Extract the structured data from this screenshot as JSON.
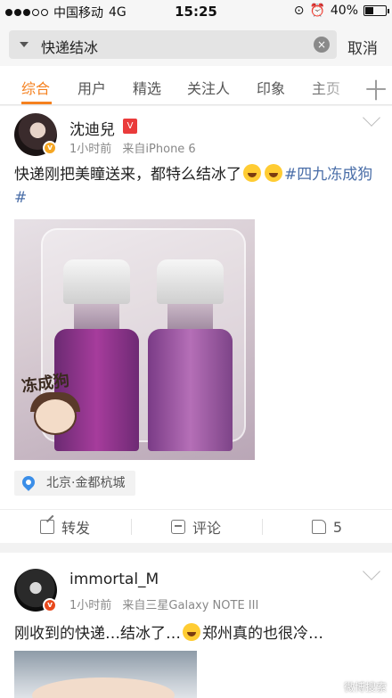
{
  "status_bar": {
    "carrier": "中国移动",
    "network": "4G",
    "time": "15:25",
    "battery": "40%",
    "battery_level": 0.4,
    "signal_bars_filled": 3,
    "signal_bars_total": 5
  },
  "search": {
    "query": "快递结冰",
    "clear_glyph": "×",
    "cancel_label": "取消"
  },
  "tabs": {
    "items": [
      "综合",
      "用户",
      "精选",
      "关注人",
      "印象",
      "主页"
    ],
    "active": "综合",
    "plus_glyph": "十",
    "accent_color": "#f5811f"
  },
  "posts": [
    {
      "username": "沈迪兒",
      "member_badge": "V",
      "verified_badge": "v",
      "time": "1小时前",
      "source": "来自iPhone 6",
      "text": "快递刚把美瞳送来，都特么结冰了",
      "hashtag": "#四九冻成狗#",
      "image_sticker_text": "冻成狗",
      "location": "北京·金都杭城",
      "actions": {
        "repost": "转发",
        "comment": "评论",
        "like_count": "5"
      }
    },
    {
      "username": "immortal_M",
      "verified_badge": "v",
      "time": "1小时前",
      "source": "来自三星Galaxy NOTE III",
      "text_before": "刚收到的快递…结冰了…",
      "text_after": "郑州真的也很冷…",
      "watermark": "微博搜索"
    }
  ]
}
